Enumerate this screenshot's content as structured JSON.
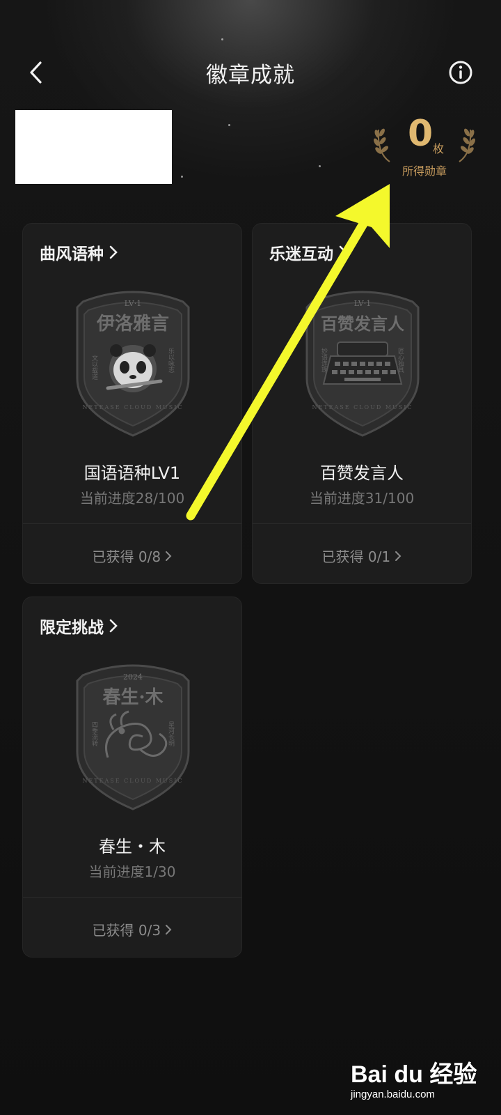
{
  "header": {
    "title": "徽章成就",
    "back_icon": "chevron-left-icon",
    "info_icon": "info-circle-icon"
  },
  "medal_summary": {
    "count": "0",
    "unit": "枚",
    "label": "所得勋章"
  },
  "categories": [
    {
      "title": "曲风语种",
      "badge_name": "国语语种LV1",
      "progress": "当前进度28/100",
      "earned": "已获得 0/8",
      "emblem": {
        "level": "LV·1",
        "name": "伊洛雅言",
        "left_motto": "文以载道",
        "right_motto": "乐以咏志",
        "footer": "NETEASE CLOUD MUSIC",
        "icon": "panda-icon"
      }
    },
    {
      "title": "乐迷互动",
      "badge_name": "百赞发言人",
      "progress": "当前进度31/100",
      "earned": "已获得 0/1",
      "emblem": {
        "level": "LV·1",
        "name": "百赞发言人",
        "left_motto": "妙语连珠",
        "right_motto": "匠心独具",
        "footer": "NETEASE CLOUD MUSIC",
        "icon": "typewriter-icon"
      }
    },
    {
      "title": "限定挑战",
      "badge_name": "春生・木",
      "progress": "当前进度1/30",
      "earned": "已获得 0/3",
      "emblem": {
        "level": "2024",
        "name": "春生·木",
        "left_motto": "四季流转",
        "right_motto": "星河长明",
        "footer": "NETEASE CLOUD MUSIC",
        "icon": "dragon-icon"
      }
    }
  ],
  "watermark": {
    "logo": "Bai du 经验",
    "url": "jingyan.baidu.com"
  },
  "colors": {
    "background": "#121212",
    "card": "#1d1d1d",
    "gold": "#e0b870",
    "annotation_arrow": "#f4f82c"
  }
}
